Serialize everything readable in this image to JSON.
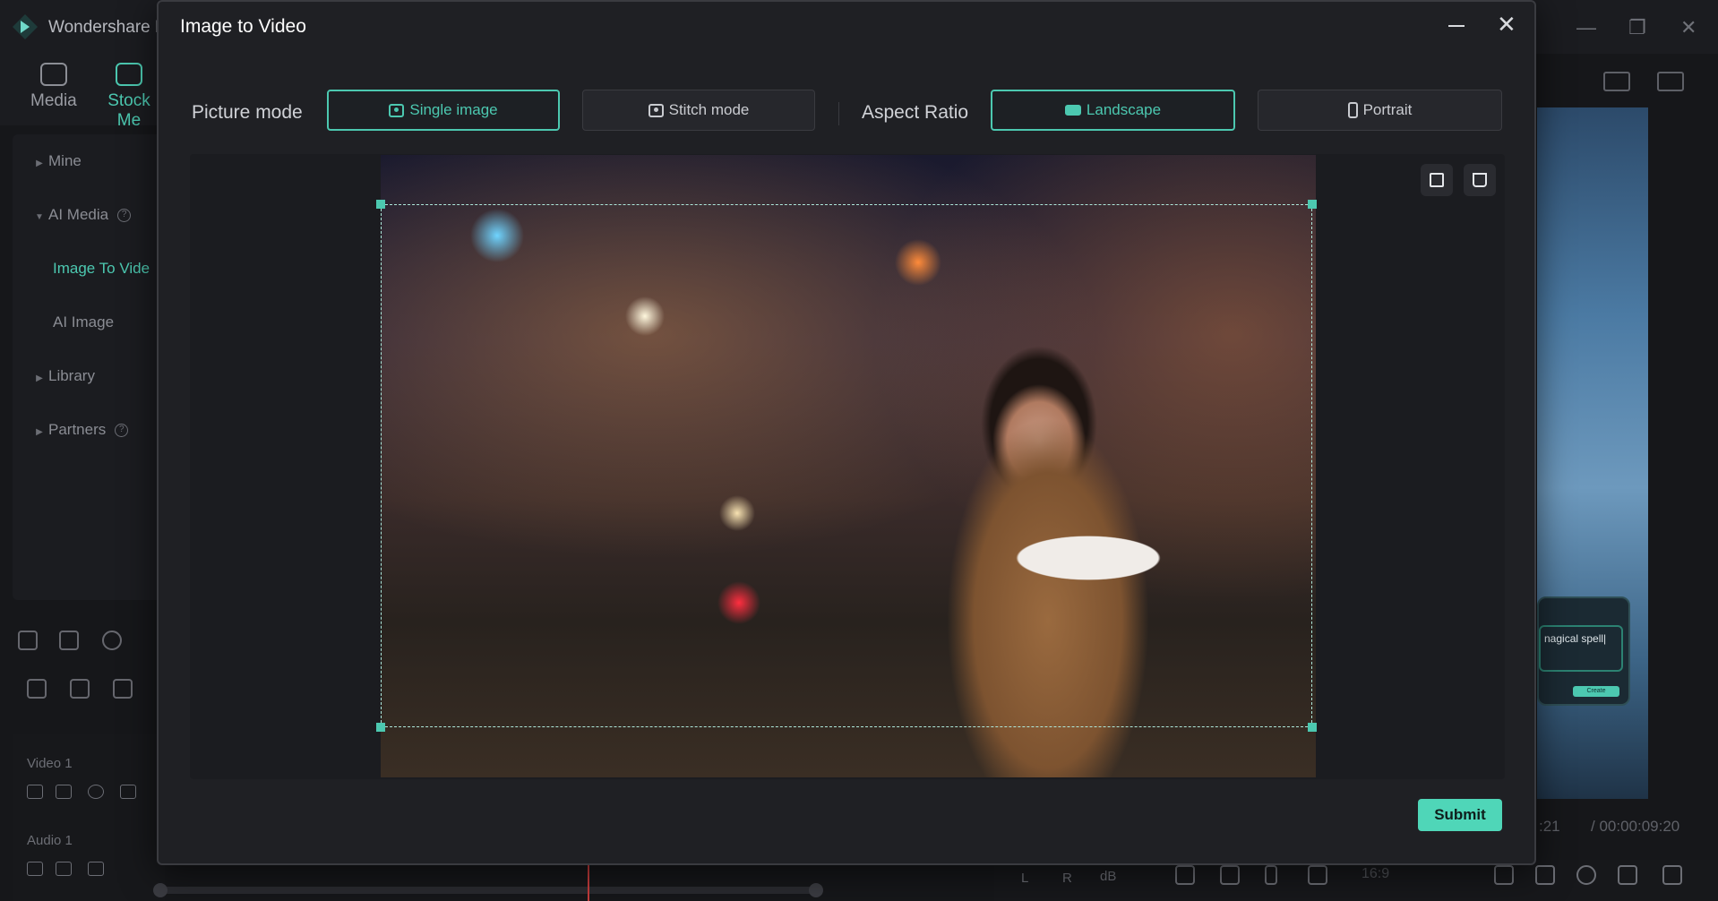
{
  "app": {
    "name": "Wondershare F",
    "nav_tabs": [
      {
        "label": "Media",
        "icon": "media-icon"
      },
      {
        "label": "Stock Me",
        "icon": "stock-media-icon"
      }
    ],
    "sidebar": {
      "items": [
        {
          "label": "Mine"
        },
        {
          "label": "AI Media"
        },
        {
          "label": "Image To Vide"
        },
        {
          "label": "AI Image"
        },
        {
          "label": "Library"
        },
        {
          "label": "Partners"
        }
      ],
      "help_glyph": "?"
    },
    "tracks": {
      "video": "Video 1",
      "audio": "Audio 1"
    },
    "preview": {
      "card_text": "nagical spell|",
      "card_button": "Create",
      "time_current": ":21",
      "time_total": "/  00:00:09:20",
      "meter_db": "dB",
      "meter_l": "L",
      "meter_r": "R",
      "ratio": "16:9"
    },
    "colors": {
      "accent": "#4cc8b0",
      "submit": "#4fd6b8",
      "background": "#16171a",
      "dialog": "#1f2024"
    }
  },
  "dialog": {
    "title": "Image to Video",
    "picture_mode": {
      "label": "Picture mode",
      "options": [
        {
          "label": "Single image",
          "icon": "image-icon",
          "selected": true
        },
        {
          "label": "Stitch mode",
          "icon": "stitch-icon",
          "selected": false
        }
      ]
    },
    "aspect_ratio": {
      "label": "Aspect Ratio",
      "options": [
        {
          "label": "Landscape",
          "icon": "landscape-icon",
          "selected": true
        },
        {
          "label": "Portrait",
          "icon": "portrait-icon",
          "selected": false
        }
      ]
    },
    "submit_label": "Submit"
  }
}
